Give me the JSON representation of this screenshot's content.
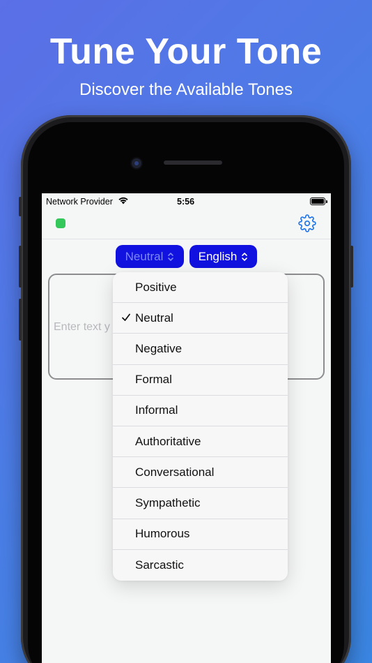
{
  "promo": {
    "headline": "Tune Your Tone",
    "subheadline": "Discover the Available Tones"
  },
  "status_bar": {
    "carrier": "Network Provider",
    "time": "5:56",
    "icons": [
      "wifi-icon",
      "battery-icon"
    ]
  },
  "toolbar": {
    "status_color": "#34c759",
    "settings_icon": "gear-icon"
  },
  "selectors": {
    "tone": "Neutral",
    "language": "English",
    "accent": "#1212e0"
  },
  "input": {
    "placeholder": "Enter text y"
  },
  "tone_menu": {
    "selected": "Neutral",
    "items": [
      {
        "label": "Positive",
        "checked": false
      },
      {
        "label": "Neutral",
        "checked": true
      },
      {
        "label": "Negative",
        "checked": false
      },
      {
        "label": "Formal",
        "checked": false
      },
      {
        "label": "Informal",
        "checked": false
      },
      {
        "label": "Authoritative",
        "checked": false
      },
      {
        "label": "Conversational",
        "checked": false
      },
      {
        "label": "Sympathetic",
        "checked": false
      },
      {
        "label": "Humorous",
        "checked": false
      },
      {
        "label": "Sarcastic",
        "checked": false
      }
    ]
  }
}
